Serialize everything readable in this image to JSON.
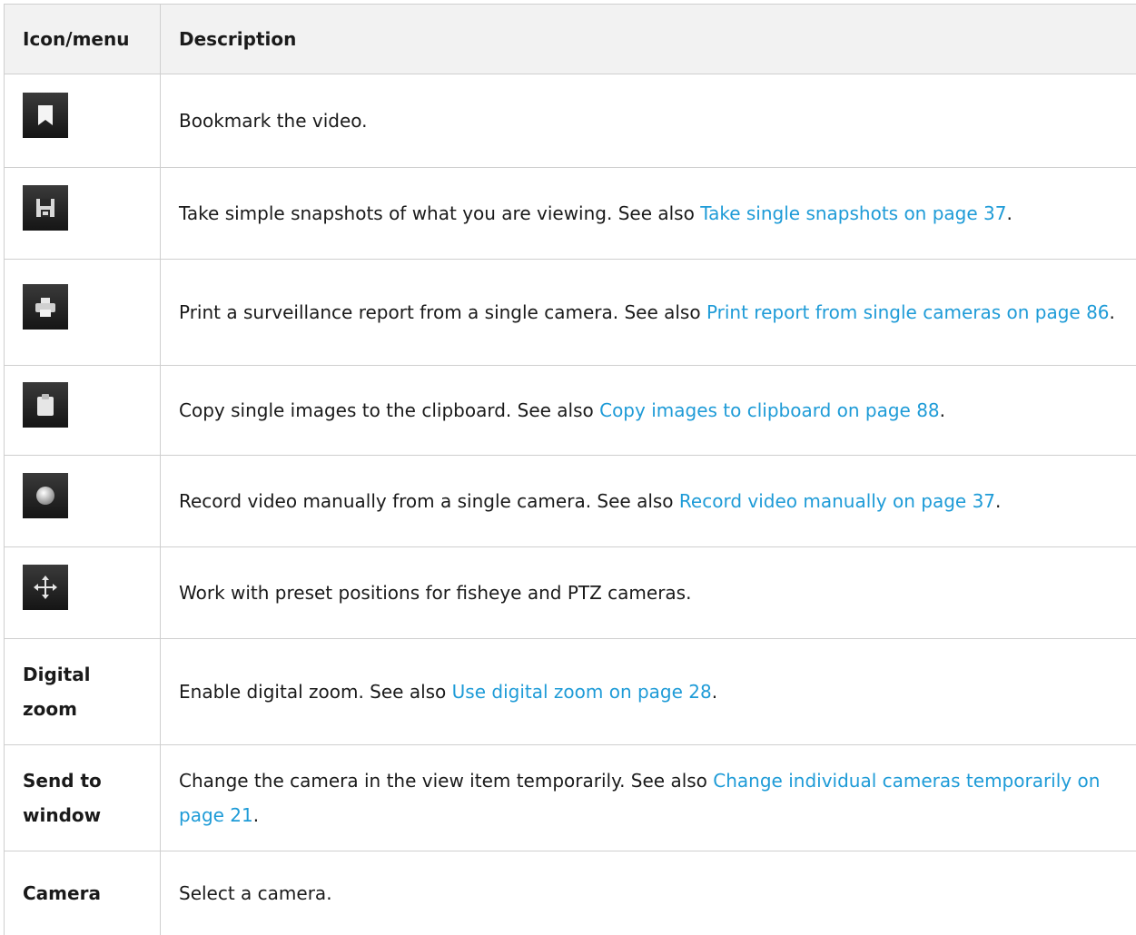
{
  "header": {
    "col1": "Icon/menu",
    "col2": "Description"
  },
  "rows": [
    {
      "icon": "bookmark-icon",
      "desc": "Bookmark the video."
    },
    {
      "icon": "save-icon",
      "desc": "Take simple snapshots of what you are viewing. See also ",
      "link": "Take single snapshots on page 37",
      "after": "."
    },
    {
      "icon": "print-icon",
      "desc": "Print a surveillance report from a single camera. See also ",
      "link": "Print report from single cameras on page 86",
      "after": "."
    },
    {
      "icon": "clipboard-icon",
      "desc": "Copy single images to the clipboard. See also ",
      "link": "Copy images to clipboard on page 88",
      "after": "."
    },
    {
      "icon": "record-icon",
      "desc": "Record video manually from a single camera. See also ",
      "link": "Record video manually on page 37",
      "after": "."
    },
    {
      "icon": "ptz-move-icon",
      "desc": "Work with preset positions for fisheye and PTZ cameras."
    },
    {
      "name": "Digital zoom",
      "desc": "Enable digital zoom. See also ",
      "link": "Use digital zoom on page 28",
      "after": "."
    },
    {
      "name": "Send to window",
      "desc": "Change the camera in the view item temporarily. See also ",
      "link": "Change individual cameras temporarily on page 21",
      "after": "."
    },
    {
      "name": "Camera",
      "desc": "Select a camera."
    }
  ],
  "colors": {
    "link": "#1e9bd7",
    "header_bg": "#f2f2f2",
    "border": "#cfcfcf"
  }
}
